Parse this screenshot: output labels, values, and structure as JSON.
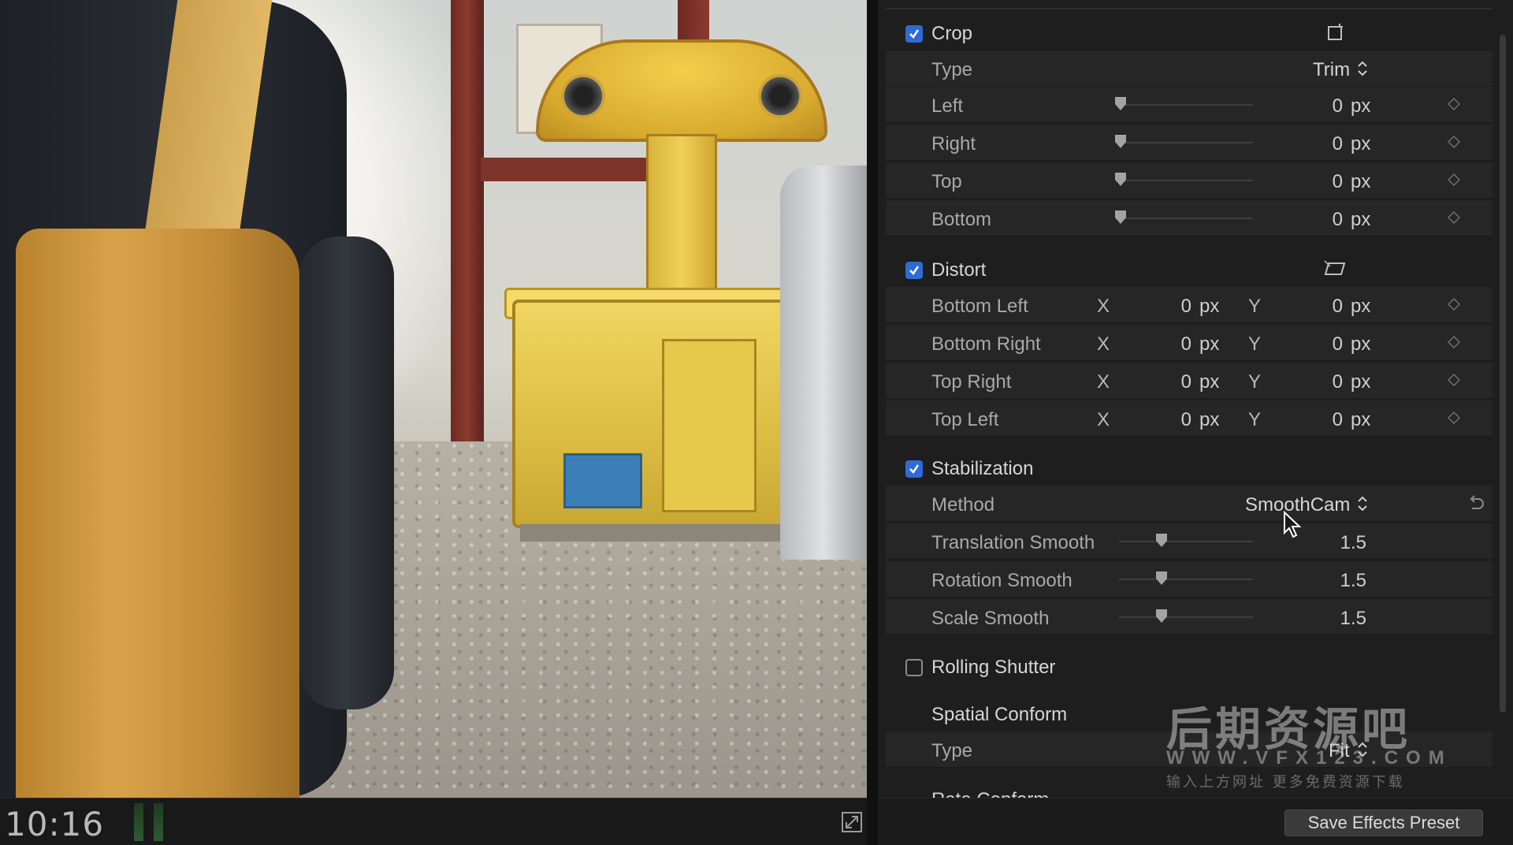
{
  "viewer": {
    "timecode": "10:16",
    "fullscreen_icon": "fullscreen-icon"
  },
  "inspector": {
    "crop": {
      "title": "Crop",
      "checked": true,
      "type_label": "Type",
      "type_value": "Trim",
      "rows": [
        {
          "label": "Left",
          "value": "0",
          "unit": "px"
        },
        {
          "label": "Right",
          "value": "0",
          "unit": "px"
        },
        {
          "label": "Top",
          "value": "0",
          "unit": "px"
        },
        {
          "label": "Bottom",
          "value": "0",
          "unit": "px"
        }
      ]
    },
    "distort": {
      "title": "Distort",
      "checked": true,
      "x_label": "X",
      "y_label": "Y",
      "rows": [
        {
          "label": "Bottom Left",
          "x": "0",
          "y": "0",
          "unit": "px"
        },
        {
          "label": "Bottom Right",
          "x": "0",
          "y": "0",
          "unit": "px"
        },
        {
          "label": "Top Right",
          "x": "0",
          "y": "0",
          "unit": "px"
        },
        {
          "label": "Top Left",
          "x": "0",
          "y": "0",
          "unit": "px"
        }
      ]
    },
    "stabilization": {
      "title": "Stabilization",
      "checked": true,
      "method_label": "Method",
      "method_value": "SmoothCam",
      "rows": [
        {
          "label": "Translation Smooth",
          "value": "1.5"
        },
        {
          "label": "Rotation Smooth",
          "value": "1.5"
        },
        {
          "label": "Scale Smooth",
          "value": "1.5"
        }
      ]
    },
    "rolling_shutter": {
      "title": "Rolling Shutter",
      "checked": false
    },
    "spatial_conform": {
      "title": "Spatial Conform",
      "type_label": "Type",
      "type_value": "Fit"
    },
    "rate_conform": {
      "title": "Rate Conform"
    }
  },
  "watermark": {
    "big": "后期资源吧",
    "url": "WWW.VFX123.COM",
    "small": "输入上方网址 更多免费资源下载"
  },
  "footer": {
    "save_preset_label": "Save Effects Preset"
  },
  "colors": {
    "checkbox_accent": "#2f6ad6",
    "panel_bg": "#1e1e1e",
    "row_bg": "#262626"
  }
}
